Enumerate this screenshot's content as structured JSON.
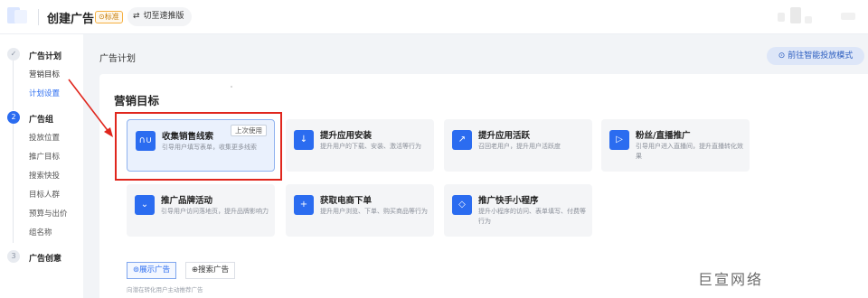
{
  "header": {
    "title": "创建广告",
    "badge": "⊙标准",
    "switch_label": "切至速推版"
  },
  "steps": [
    {
      "index": "✓",
      "title": "广告计划",
      "items": [
        "营销目标",
        "计划设置"
      ]
    },
    {
      "index": "2",
      "title": "广告组",
      "items": [
        "投放位置",
        "推广目标",
        "搜索快投",
        "目标人群",
        "预算与出价",
        "组名称"
      ]
    },
    {
      "index": "3",
      "title": "广告创意",
      "items": []
    }
  ],
  "section": {
    "title": "广告计划",
    "smart_button": "前往智能投放模式"
  },
  "panel": {
    "title": "营销目标",
    "cards": [
      {
        "title": "收集销售线索",
        "desc": "引导用户填写表单，收集更多线索",
        "tag": "上次使用",
        "icon": "form-icon",
        "icon_glyph": "∩∪"
      },
      {
        "title": "提升应用安装",
        "desc": "提升用户的下载、安装、激活等行为",
        "icon": "download-icon",
        "icon_glyph": "↓"
      },
      {
        "title": "提升应用活跃",
        "desc": "召回老用户，提升用户活跃度",
        "icon": "monitor-icon",
        "icon_glyph": "↗"
      },
      {
        "title": "粉丝/直播推广",
        "desc": "引导用户进入直播间，提升直播转化效果",
        "icon": "video-icon",
        "icon_glyph": "▷"
      },
      {
        "title": "推广品牌活动",
        "desc": "引导用户访问落地页，提升品牌影响力",
        "icon": "brand-icon",
        "icon_glyph": "⌄"
      },
      {
        "title": "获取电商下单",
        "desc": "提升用户浏览、下单、购买商品等行为",
        "icon": "cart-icon",
        "icon_glyph": "+"
      },
      {
        "title": "推广快手小程序",
        "desc": "提升小程序的访问、表单填写、付费等行为",
        "icon": "miniapp-icon",
        "icon_glyph": "◇"
      }
    ],
    "tabs": [
      "展示广告",
      "搜索广告"
    ],
    "hint": "向潜在转化用户主动推荐广告"
  },
  "watermark": "巨宣网络",
  "colors": {
    "accent": "#2b6cf0",
    "highlight": "#e0261d"
  }
}
